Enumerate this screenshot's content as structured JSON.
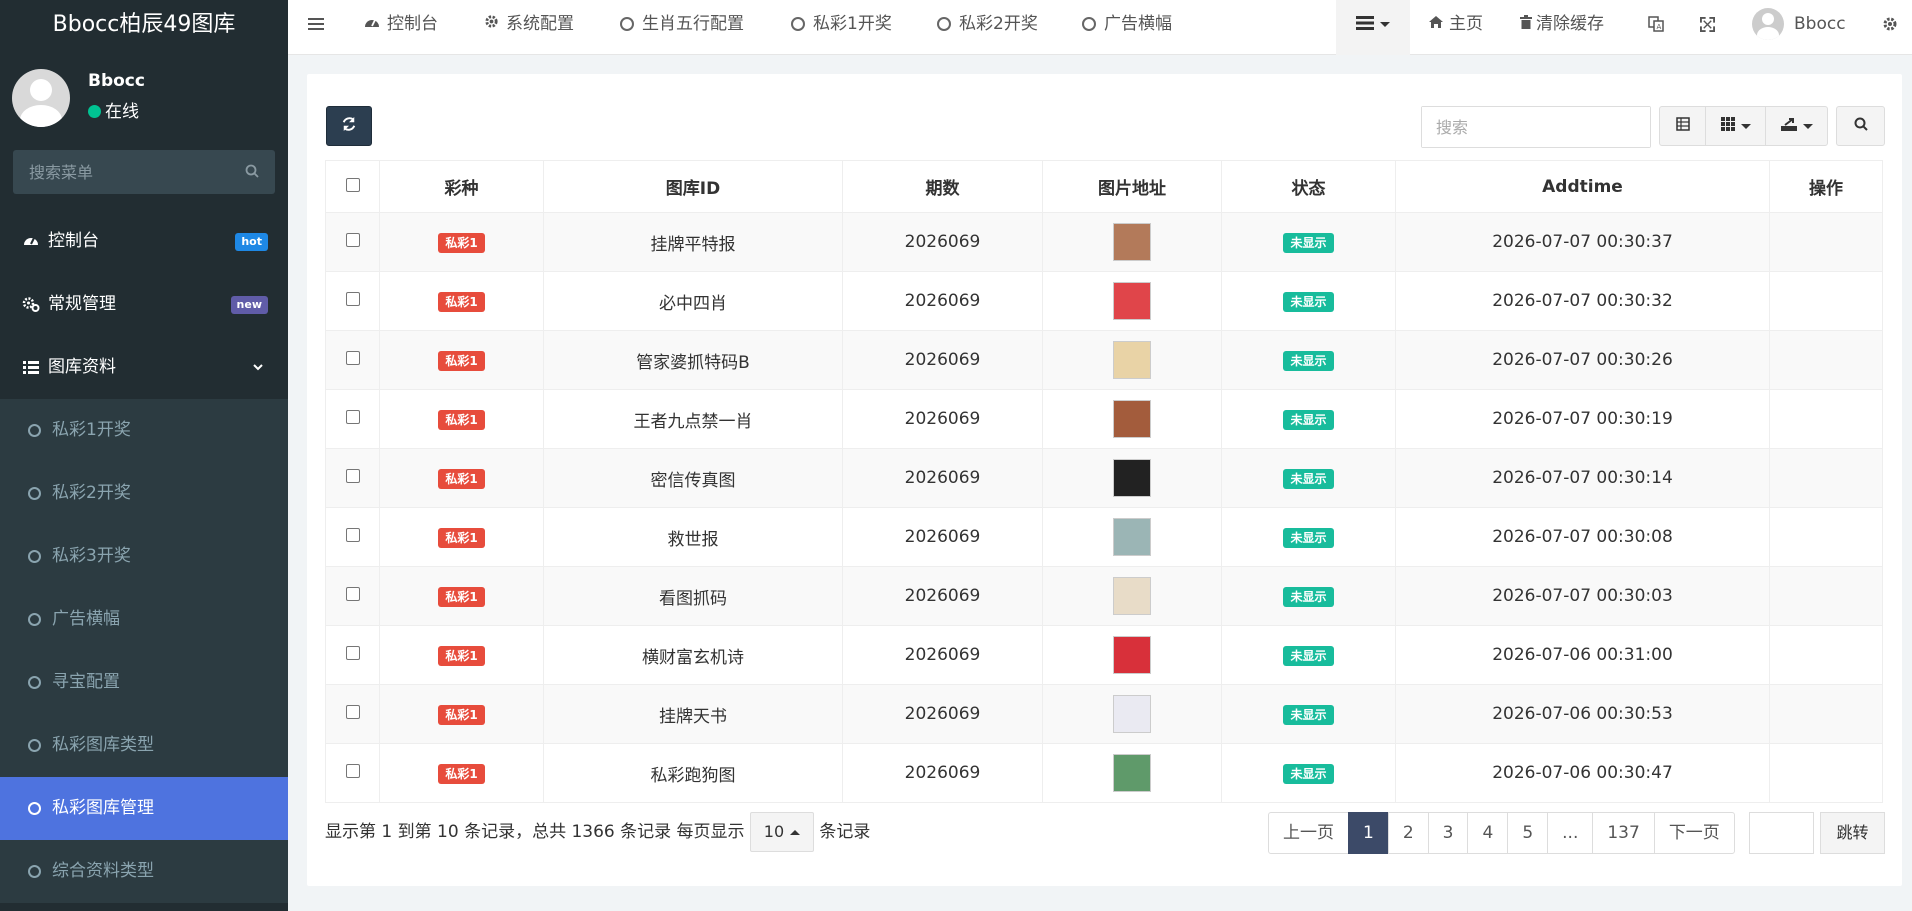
{
  "app": {
    "brand": "Bbocc柏辰49图库"
  },
  "user": {
    "name": "Bbocc",
    "status": "在线"
  },
  "sidebar": {
    "search_placeholder": "搜索菜单",
    "top_items": [
      {
        "label": "控制台",
        "badge": "hot",
        "icon": "dashboard-icon"
      },
      {
        "label": "常规管理",
        "badge": "new",
        "icon": "cogs-icon"
      },
      {
        "label": "图库资料",
        "icon": "list-icon"
      }
    ],
    "sub_items": [
      {
        "label": "私彩1开奖"
      },
      {
        "label": "私彩2开奖"
      },
      {
        "label": "私彩3开奖"
      },
      {
        "label": "广告横幅"
      },
      {
        "label": "寻宝配置"
      },
      {
        "label": "私彩图库类型"
      },
      {
        "label": "私彩图库管理",
        "active": true
      },
      {
        "label": "综合资料类型"
      }
    ]
  },
  "topnav": {
    "items": [
      "控制台",
      "系统配置",
      "生肖五行配置",
      "私彩1开奖",
      "私彩2开奖",
      "广告横幅"
    ],
    "home": "主页",
    "clear_cache": "清除缓存",
    "username": "Bbocc"
  },
  "toolbar": {
    "search_placeholder": "搜索"
  },
  "table": {
    "headers": [
      "彩种",
      "图库ID",
      "期数",
      "图片地址",
      "状态",
      "Addtime",
      "操作"
    ],
    "rows": [
      {
        "type": "私彩1",
        "name": "挂牌平特报",
        "issue": "2026069",
        "status": "未显示",
        "time": "2026-07-07 00:30:37",
        "thumb": "#b37a5a"
      },
      {
        "type": "私彩1",
        "name": "必中四肖",
        "issue": "2026069",
        "status": "未显示",
        "time": "2026-07-07 00:30:32",
        "thumb": "#e0454a"
      },
      {
        "type": "私彩1",
        "name": "管家婆抓特码B",
        "issue": "2026069",
        "status": "未显示",
        "time": "2026-07-07 00:30:26",
        "thumb": "#e9d3a6"
      },
      {
        "type": "私彩1",
        "name": "王者九点禁一肖",
        "issue": "2026069",
        "status": "未显示",
        "time": "2026-07-07 00:30:19",
        "thumb": "#a35c3c"
      },
      {
        "type": "私彩1",
        "name": "密信传真图",
        "issue": "2026069",
        "status": "未显示",
        "time": "2026-07-07 00:30:14",
        "thumb": "#222222"
      },
      {
        "type": "私彩1",
        "name": "救世报",
        "issue": "2026069",
        "status": "未显示",
        "time": "2026-07-07 00:30:08",
        "thumb": "#9bb5b5"
      },
      {
        "type": "私彩1",
        "name": "看图抓码",
        "issue": "2026069",
        "status": "未显示",
        "time": "2026-07-07 00:30:03",
        "thumb": "#e8dcc8"
      },
      {
        "type": "私彩1",
        "name": "横财富玄机诗",
        "issue": "2026069",
        "status": "未显示",
        "time": "2026-07-06 00:31:00",
        "thumb": "#d8303a"
      },
      {
        "type": "私彩1",
        "name": "挂牌天书",
        "issue": "2026069",
        "status": "未显示",
        "time": "2026-07-06 00:30:53",
        "thumb": "#eaeaf2"
      },
      {
        "type": "私彩1",
        "name": "私彩跑狗图",
        "issue": "2026069",
        "status": "未显示",
        "time": "2026-07-06 00:30:47",
        "thumb": "#5f9a6a"
      }
    ]
  },
  "footer": {
    "info_prefix": "显示第 1 到第 10 条记录，总共 1366 条记录 每页显示",
    "page_size": "10",
    "info_suffix": "条记录",
    "pages": [
      "上一页",
      "1",
      "2",
      "3",
      "4",
      "5",
      "...",
      "137",
      "下一页"
    ],
    "active_page": "1",
    "jump": "跳转"
  }
}
